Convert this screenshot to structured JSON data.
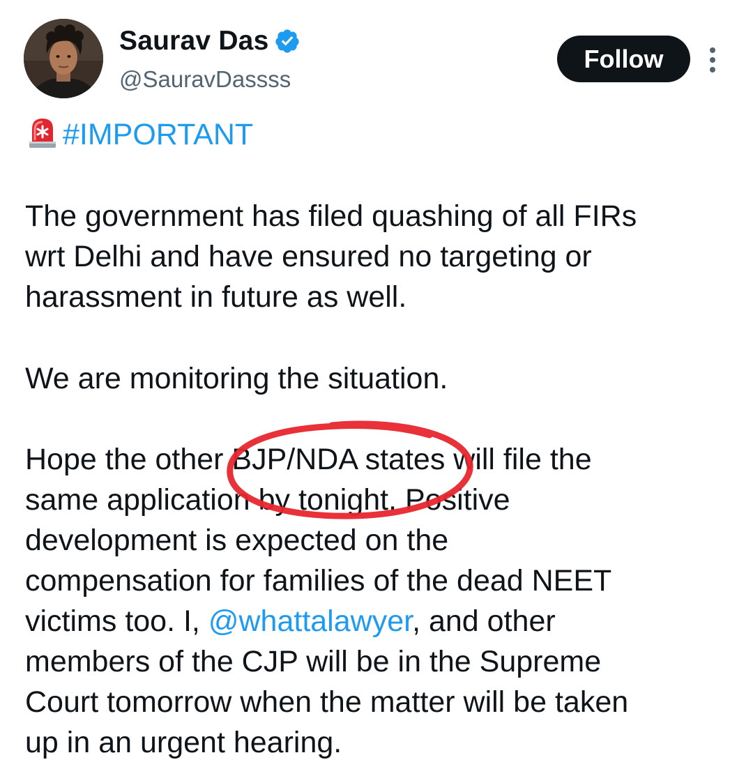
{
  "author": {
    "display_name": "Saurav Das",
    "handle": "@SauravDassss",
    "verified": true,
    "verified_color": "#1d9bf0"
  },
  "actions": {
    "follow_label": "Follow",
    "more_icon": "more-vertical-icon"
  },
  "tweet": {
    "hashtag": "#IMPORTANT",
    "hashtag_icon": "siren-emoji",
    "paragraph1": [
      "The government has filed quashing of all FIRs",
      "wrt Delhi and have ensured no targeting or",
      "harassment in future as well."
    ],
    "paragraph2": [
      "We are monitoring the situation."
    ],
    "paragraph3": {
      "line1": "Hope the other BJP/NDA states will file the",
      "line2": "same application by tonight. Positive",
      "line3": "development is expected on the",
      "line4": "compensation for families of the dead NEET",
      "line5_before": "victims too. I, ",
      "line5_mention": "@whattalawyer",
      "line5_after": ", and other",
      "line6": "members of the CJP will be in the Supreme",
      "line7": "Court tomorrow when the matter will be taken",
      "line8": "up in an urgent hearing."
    }
  },
  "annotation": {
    "type": "hand-drawn circle",
    "color": "#e8262f"
  },
  "colors": {
    "text": "#0f1419",
    "secondary_text": "#536471",
    "link": "#1d9bf0",
    "button_bg": "#0f1419",
    "button_text": "#ffffff"
  }
}
